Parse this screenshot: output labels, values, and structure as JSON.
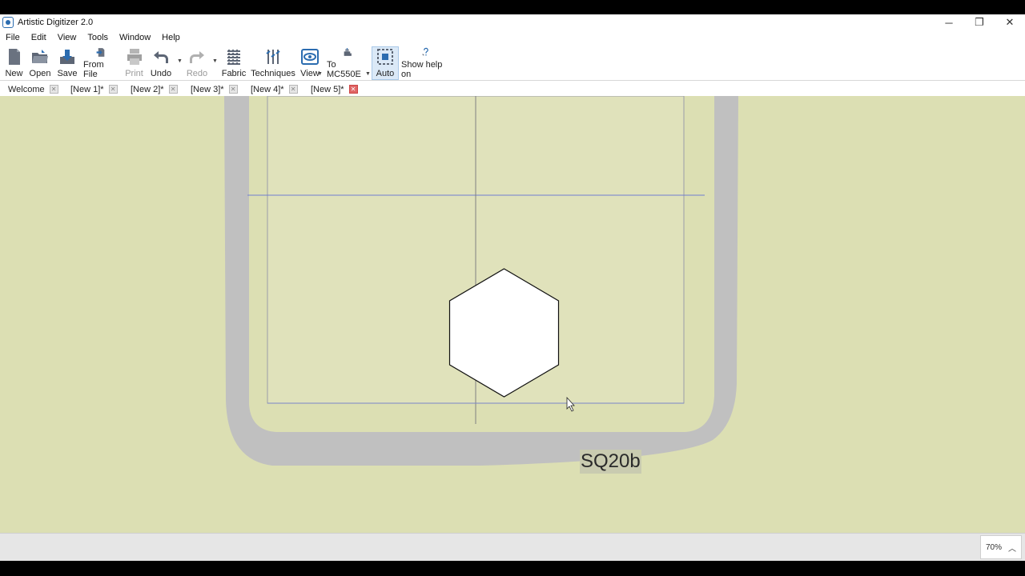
{
  "window": {
    "title": "Artistic Digitizer 2.0",
    "minimize": "─",
    "maximize": "❐",
    "close": "✕"
  },
  "menu": [
    "File",
    "Edit",
    "View",
    "Tools",
    "Window",
    "Help"
  ],
  "toolbar": {
    "new": "New",
    "open": "Open",
    "save": "Save",
    "from_file": "From File",
    "print": "Print",
    "undo": "Undo",
    "redo": "Redo",
    "fabric": "Fabric",
    "techniques": "Techniques",
    "view": "View",
    "to_machine": "To MC550E",
    "auto": "Auto",
    "show_help": "Show help on"
  },
  "tabs": [
    {
      "label": "Welcome",
      "active": false
    },
    {
      "label": "[New 1]*",
      "active": false
    },
    {
      "label": "[New 2]*",
      "active": false
    },
    {
      "label": "[New 3]*",
      "active": false
    },
    {
      "label": "[New 4]*",
      "active": false
    },
    {
      "label": "[New 5]*",
      "active": true
    }
  ],
  "hoop": {
    "name": "SQ20b"
  },
  "status": {
    "zoom": "70%"
  },
  "colors": {
    "canvas": "#dcdfb3",
    "hoop": "#c0c0c0",
    "guide": "#6f7fd0",
    "tab_close_active": "#e06666"
  }
}
